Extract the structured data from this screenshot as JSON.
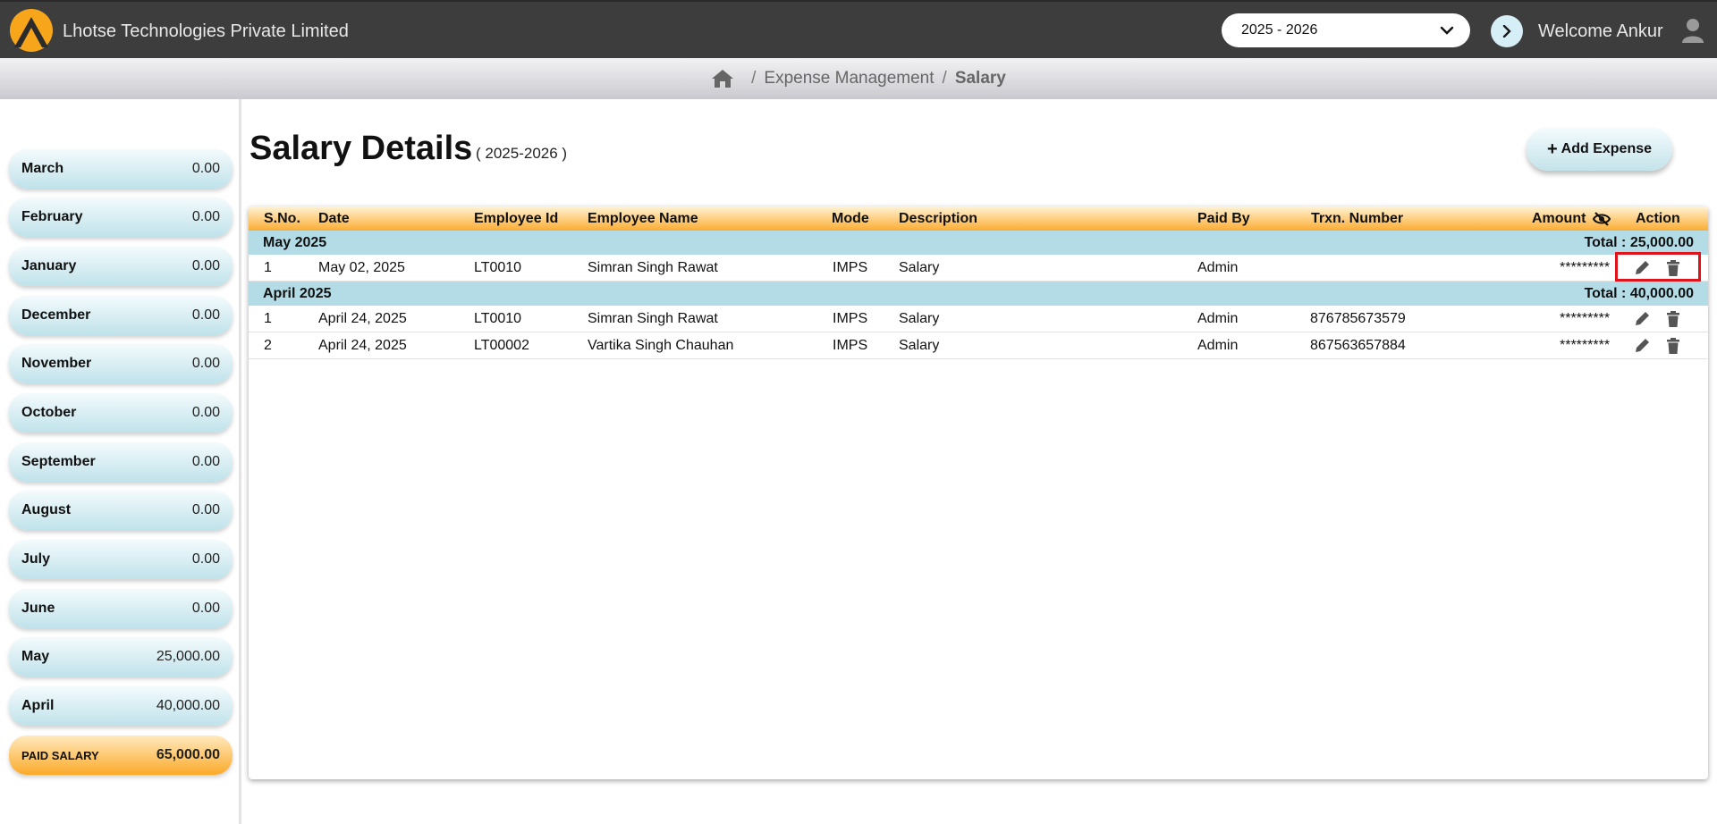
{
  "header": {
    "company": "Lhotse Technologies Private Limited",
    "fy_selected": "2025 - 2026",
    "welcome": "Welcome Ankur"
  },
  "breadcrumb": {
    "sep": "/",
    "parent": "Expense Management",
    "current": "Salary"
  },
  "sidebar": {
    "months": [
      {
        "name": "March",
        "value": "0.00"
      },
      {
        "name": "February",
        "value": "0.00"
      },
      {
        "name": "January",
        "value": "0.00"
      },
      {
        "name": "December",
        "value": "0.00"
      },
      {
        "name": "November",
        "value": "0.00"
      },
      {
        "name": "October",
        "value": "0.00"
      },
      {
        "name": "September",
        "value": "0.00"
      },
      {
        "name": "August",
        "value": "0.00"
      },
      {
        "name": "July",
        "value": "0.00"
      },
      {
        "name": "June",
        "value": "0.00"
      },
      {
        "name": "May",
        "value": "25,000.00"
      },
      {
        "name": "April",
        "value": "40,000.00"
      }
    ],
    "total": {
      "name": "PAID SALARY",
      "value": "65,000.00"
    }
  },
  "main": {
    "title": "Salary Details",
    "subtitle": "( 2025-2026 )",
    "add_label": "Add Expense",
    "add_plus": "+"
  },
  "table": {
    "columns": {
      "sno": "S.No.",
      "date": "Date",
      "emp_id": "Employee Id",
      "emp_name": "Employee Name",
      "mode": "Mode",
      "desc": "Description",
      "paid_by": "Paid By",
      "trxn": "Trxn. Number",
      "amount": "Amount",
      "action": "Action"
    },
    "groups": [
      {
        "label": "May 2025",
        "total": "Total : 25,000.00",
        "rows": [
          {
            "sno": "1",
            "date": "May 02, 2025",
            "emp_id": "LT0010",
            "emp_name": "Simran Singh Rawat",
            "mode": "IMPS",
            "desc": "Salary",
            "paid_by": "Admin",
            "trxn": "",
            "amount": "*********"
          }
        ]
      },
      {
        "label": "April 2025",
        "total": "Total : 40,000.00",
        "rows": [
          {
            "sno": "1",
            "date": "April 24, 2025",
            "emp_id": "LT0010",
            "emp_name": "Simran Singh Rawat",
            "mode": "IMPS",
            "desc": "Salary",
            "paid_by": "Admin",
            "trxn": "876785673579",
            "amount": "*********"
          },
          {
            "sno": "2",
            "date": "April 24, 2025",
            "emp_id": "LT00002",
            "emp_name": "Vartika Singh Chauhan",
            "mode": "IMPS",
            "desc": "Salary",
            "paid_by": "Admin",
            "trxn": "867563657884",
            "amount": "*********"
          }
        ]
      }
    ]
  },
  "icons": {
    "logo": "logo-icon",
    "home": "home-icon",
    "eye": "eye-slash-icon",
    "edit": "pencil-icon",
    "delete": "trash-icon",
    "user": "user-icon"
  },
  "colors": {
    "topbar": "#3d3d3d",
    "accent_orange": "#fbac32",
    "accent_blue": "#b3dce6",
    "highlight": "#e0121c"
  }
}
